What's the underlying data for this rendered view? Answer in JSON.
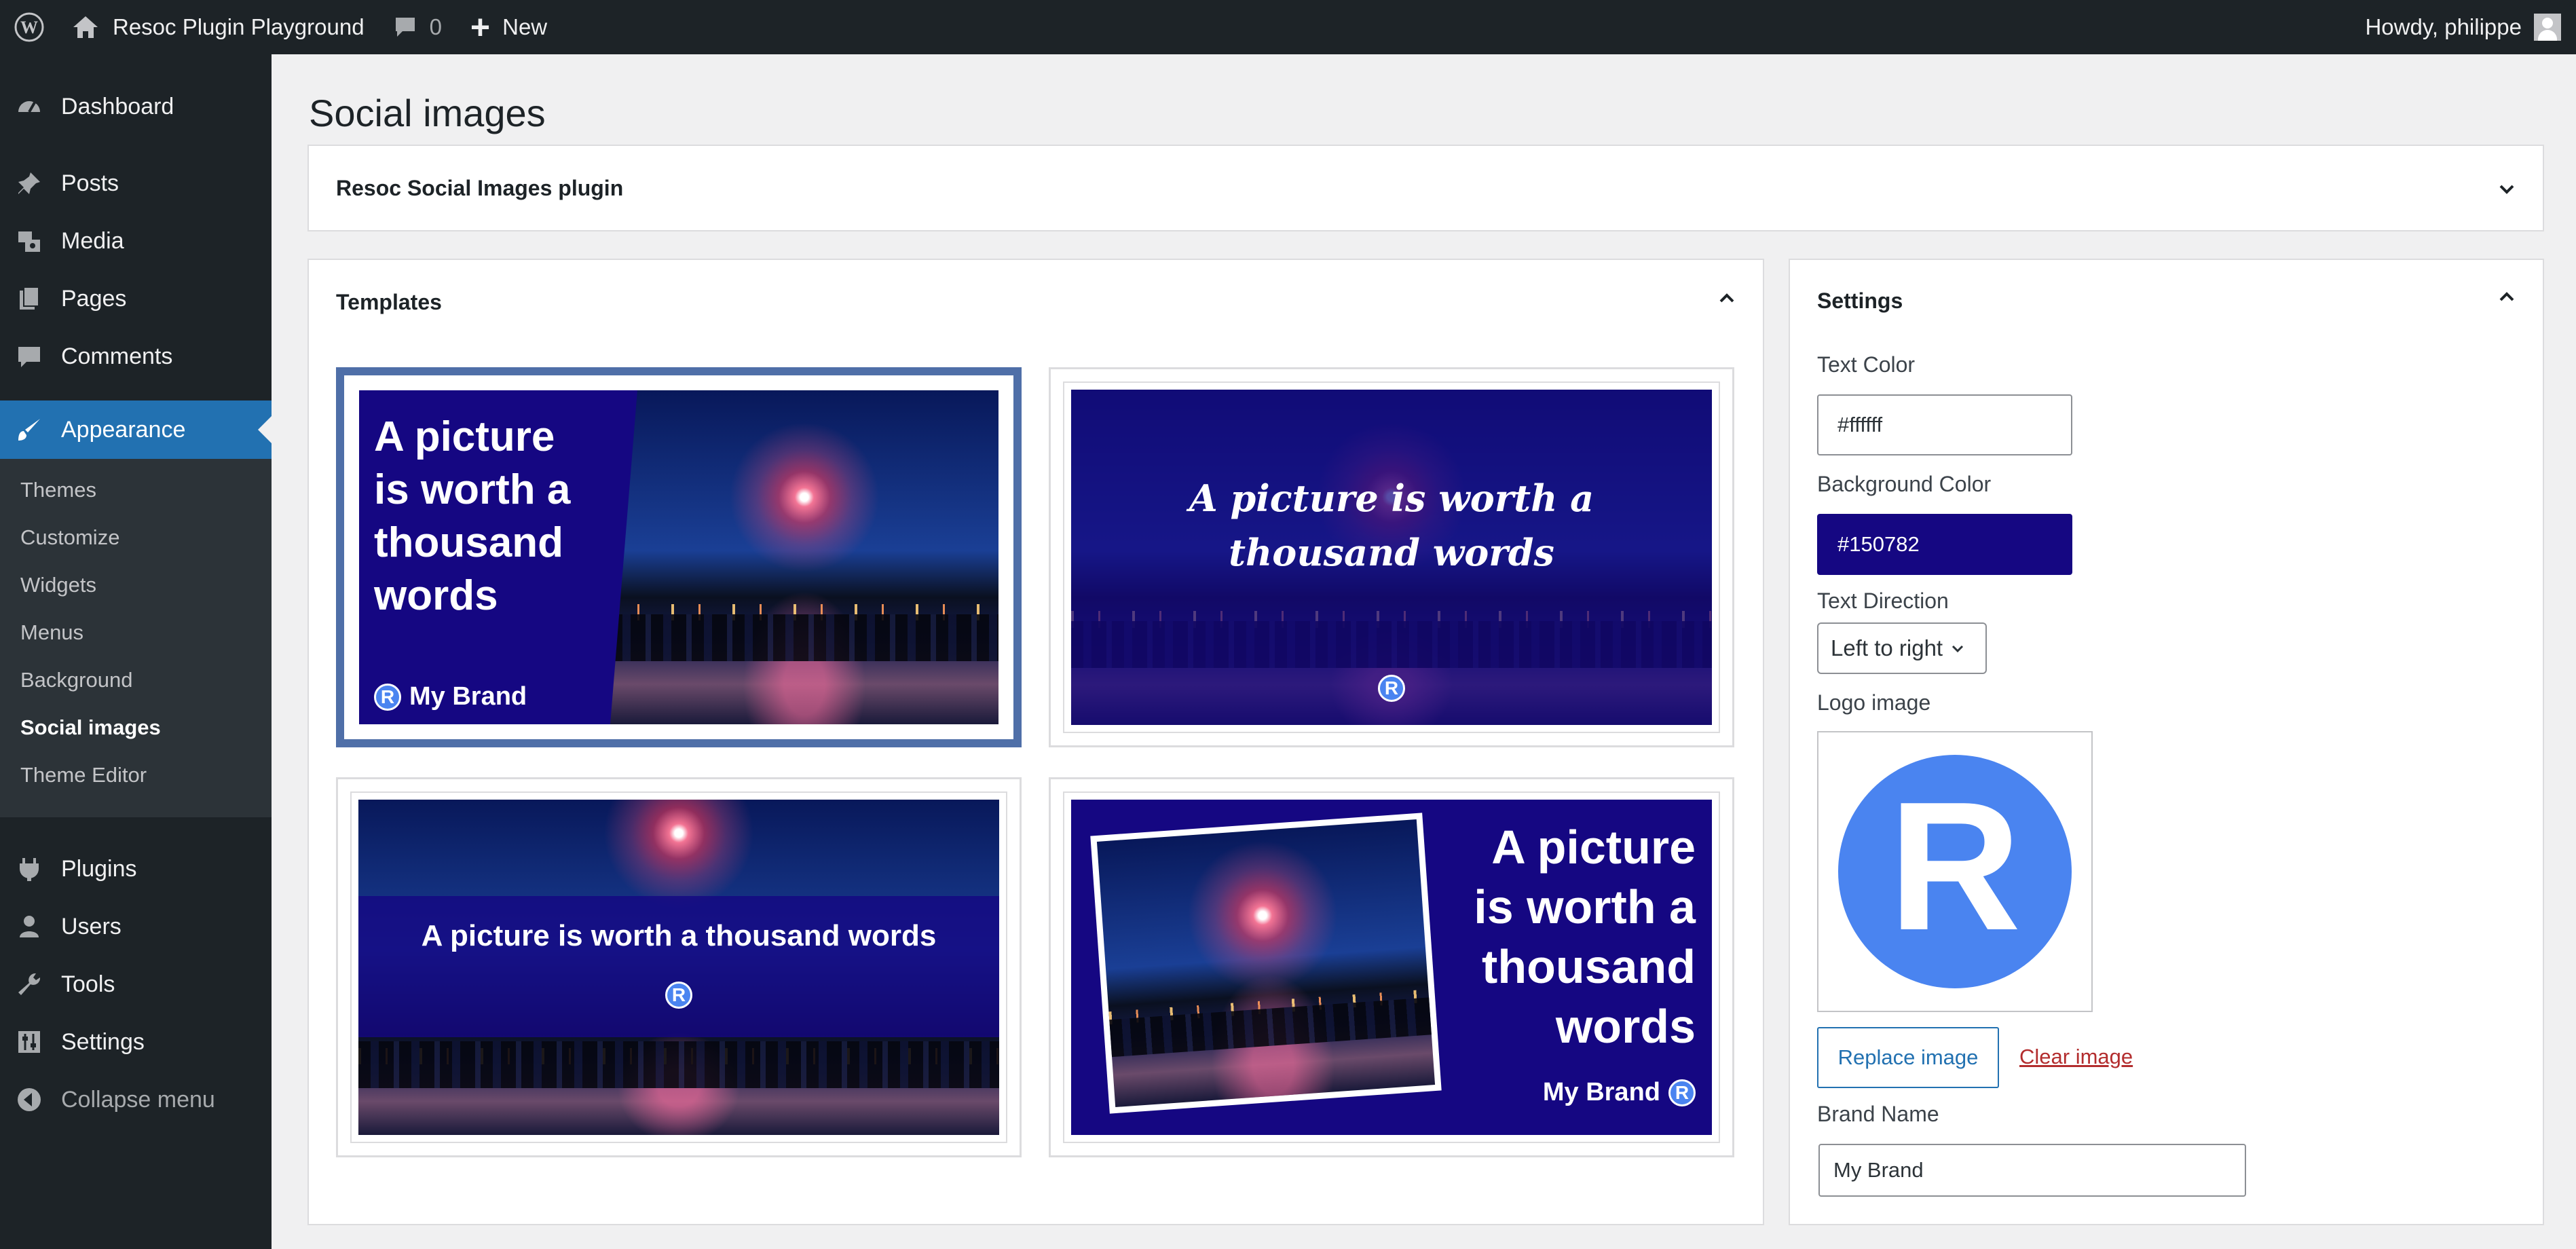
{
  "admin_bar": {
    "logo": "wordpress-logo-icon",
    "site_name": "Resoc Plugin Playground",
    "comments_count": "0",
    "new_label": "New",
    "howdy": "Howdy, philippe"
  },
  "sidebar": {
    "items": [
      {
        "label": "Dashboard",
        "icon": "dashboard-icon"
      },
      {
        "label": "Posts",
        "icon": "pin-icon"
      },
      {
        "label": "Media",
        "icon": "media-icon"
      },
      {
        "label": "Pages",
        "icon": "pages-icon"
      },
      {
        "label": "Comments",
        "icon": "comment-icon"
      },
      {
        "label": "Appearance",
        "icon": "paintbrush-icon"
      },
      {
        "label": "Plugins",
        "icon": "plugin-icon"
      },
      {
        "label": "Users",
        "icon": "users-icon"
      },
      {
        "label": "Tools",
        "icon": "wrench-icon"
      },
      {
        "label": "Settings",
        "icon": "settings-icon"
      },
      {
        "label": "Collapse menu",
        "icon": "collapse-icon"
      }
    ],
    "submenu": [
      "Themes",
      "Customize",
      "Widgets",
      "Menus",
      "Background",
      "Social images",
      "Theme Editor"
    ],
    "current_submenu": "Social images"
  },
  "page": {
    "title": "Social images",
    "plugin_panel_title": "Resoc Social Images plugin"
  },
  "templates": {
    "title": "Templates",
    "headline": "A picture is worth a thousand words",
    "tpl1": {
      "lines": [
        "A picture",
        "is worth a",
        "thousand",
        "words"
      ],
      "brand": "My Brand"
    },
    "tpl2": {
      "text": "A picture is worth a thousand words"
    },
    "tpl3": {
      "text": "A picture is worth a thousand words"
    },
    "tpl4": {
      "lines": [
        "A picture",
        "is worth a",
        "thousand",
        "words"
      ],
      "brand": "My Brand"
    },
    "logo_letter": "R",
    "selected_index": 0
  },
  "settings": {
    "title": "Settings",
    "text_color_label": "Text Color",
    "text_color_value": "#ffffff",
    "background_color_label": "Background Color",
    "background_color_value": "#150782",
    "text_direction_label": "Text Direction",
    "text_direction_value": "Left to right",
    "logo_label": "Logo image",
    "logo_letter": "R",
    "replace_label": "Replace image",
    "clear_label": "Clear image",
    "brand_label": "Brand Name",
    "brand_value": "My Brand"
  },
  "colors": {
    "admin_dark": "#1d2327",
    "accent": "#2271b1",
    "template_bg": "#150782",
    "logo_blue": "#4a84f0",
    "danger": "#b32d2e"
  }
}
